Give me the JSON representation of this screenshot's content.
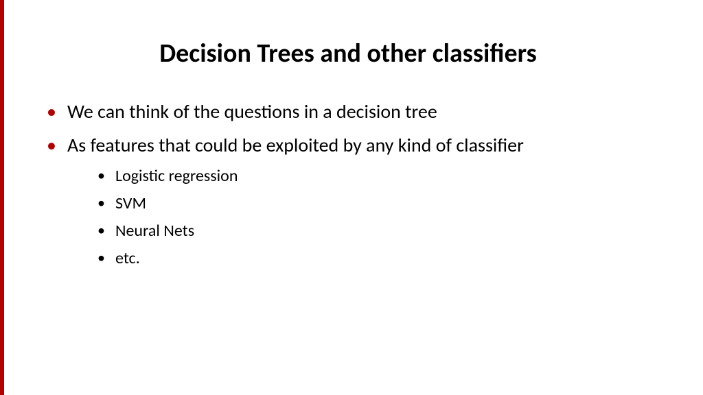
{
  "slide": {
    "title": "Decision Trees and other classifiers",
    "bullets": [
      "We can think of the questions in a decision tree",
      "As features that could be exploited by any kind of classifier"
    ],
    "subbullets": [
      "Logistic regression",
      "SVM",
      "Neural Nets",
      "etc."
    ]
  }
}
